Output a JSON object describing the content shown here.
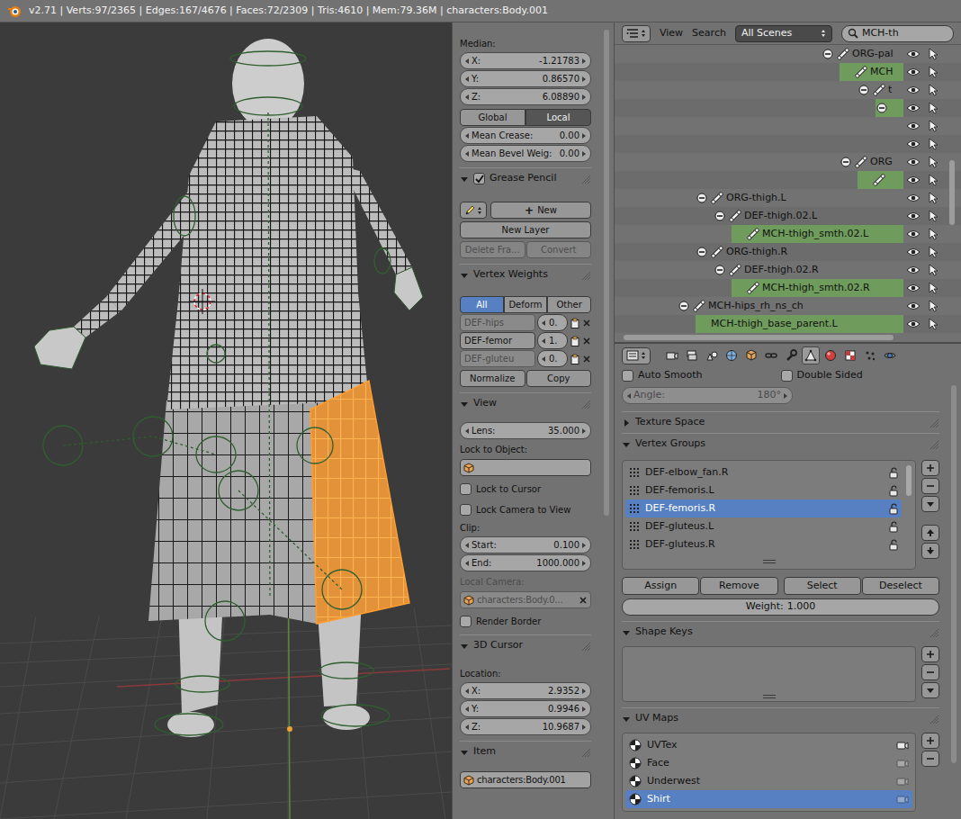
{
  "info_bar": {
    "text": "v2.71 | Verts:97/2365 | Edges:167/4676 | Faces:72/2309 | Tris:4610 | Mem:79.36M | characters:Body.001"
  },
  "n_panel": {
    "rows": [
      {
        "kind": "label",
        "text": "Median:",
        "disabled": false
      },
      {
        "kind": "number",
        "label": "X:",
        "value": "-1.21783"
      },
      {
        "kind": "number",
        "label": "Y:",
        "value": "0.86570"
      },
      {
        "kind": "number",
        "label": "Z:",
        "value": "6.08890"
      },
      {
        "kind": "radio",
        "items": [
          {
            "label": "Global",
            "selected": false
          },
          {
            "label": "Local",
            "selected": true
          }
        ]
      },
      {
        "kind": "number",
        "label": "Mean Crease:",
        "value": "0.00"
      },
      {
        "kind": "number",
        "label": "Mean Bevel Weig:",
        "value": "0.00"
      },
      {
        "kind": "header",
        "title": "Grease Pencil",
        "expanded": true,
        "checkbox": true,
        "checked": true
      },
      {
        "kind": "gp_new",
        "icon": "+",
        "label": "New"
      },
      {
        "kind": "buttons",
        "items": [
          {
            "label": "New Layer",
            "disabled": false
          }
        ]
      },
      {
        "kind": "buttons",
        "items": [
          {
            "label": "Delete Fra...",
            "disabled": true
          },
          {
            "label": "Convert",
            "disabled": true
          }
        ]
      },
      {
        "kind": "header",
        "title": "Vertex Weights",
        "expanded": true,
        "checkbox": false,
        "checked": false
      },
      {
        "kind": "toggles",
        "items": [
          {
            "label": "All",
            "selected": true
          },
          {
            "label": "Deform",
            "selected": false
          },
          {
            "label": "Other",
            "selected": false
          }
        ]
      },
      {
        "kind": "weight",
        "name": "DEF-hips",
        "value": "0.",
        "active": false
      },
      {
        "kind": "weight",
        "name": "DEF-femor",
        "value": "1.",
        "active": true
      },
      {
        "kind": "weight",
        "name": "DEF-gluteu",
        "value": "0.",
        "active": false
      },
      {
        "kind": "buttons",
        "items": [
          {
            "label": "Normalize",
            "disabled": false
          },
          {
            "label": "Copy",
            "disabled": false
          }
        ]
      },
      {
        "kind": "header",
        "title": "View",
        "expanded": true,
        "checkbox": false,
        "checked": false
      },
      {
        "kind": "number",
        "label": "Lens:",
        "value": "35.000"
      },
      {
        "kind": "label",
        "text": "Lock to Object:",
        "disabled": false
      },
      {
        "kind": "object_field",
        "value": "",
        "disabled": false,
        "clear": false
      },
      {
        "kind": "checkbox",
        "label": "Lock to Cursor",
        "checked": false
      },
      {
        "kind": "checkbox",
        "label": "Lock Camera to View",
        "checked": false
      },
      {
        "kind": "label",
        "text": "Clip:",
        "disabled": false
      },
      {
        "kind": "number",
        "label": "Start:",
        "value": "0.100"
      },
      {
        "kind": "number",
        "label": "End:",
        "value": "1000.000"
      },
      {
        "kind": "label",
        "text": "Local Camera:",
        "disabled": true
      },
      {
        "kind": "object_field",
        "value": "characters:Body.0...",
        "disabled": true,
        "clear": true
      },
      {
        "kind": "checkbox",
        "label": "Render Border",
        "checked": false
      },
      {
        "kind": "header",
        "title": "3D Cursor",
        "expanded": true,
        "checkbox": false,
        "checked": false
      },
      {
        "kind": "label",
        "text": "Location:",
        "disabled": false
      },
      {
        "kind": "number",
        "label": "X:",
        "value": "2.9352"
      },
      {
        "kind": "number",
        "label": "Y:",
        "value": "0.9946"
      },
      {
        "kind": "number",
        "label": "Z:",
        "value": "10.9687"
      },
      {
        "kind": "header",
        "title": "Item",
        "expanded": true,
        "checkbox": false,
        "checked": false
      },
      {
        "kind": "object_field",
        "value": "characters:Body.001",
        "disabled": false,
        "clear": false
      }
    ]
  },
  "outliner": {
    "header": {
      "view": "View",
      "search": "Search",
      "scene": "All Scenes",
      "filter": "MCH-th"
    },
    "rows": [
      {
        "label": "ORG-pal",
        "depth": 8,
        "has_children": true,
        "expanded": true,
        "bone": true,
        "selected": false
      },
      {
        "label": "MCH",
        "depth": 9,
        "has_children": false,
        "expanded": false,
        "bone": true,
        "selected": true
      },
      {
        "label": "t",
        "depth": 10,
        "has_children": true,
        "expanded": true,
        "bone": true,
        "selected": false
      },
      {
        "label": "",
        "depth": 11,
        "has_children": true,
        "expanded": true,
        "bone": false,
        "selected": true
      },
      {
        "label": "",
        "depth": 11,
        "has_children": false,
        "expanded": false,
        "bone": false,
        "selected": false
      },
      {
        "label": "",
        "depth": 11,
        "has_children": false,
        "expanded": false,
        "bone": false,
        "selected": false
      },
      {
        "label": "ORG",
        "depth": 9,
        "has_children": true,
        "expanded": true,
        "bone": true,
        "selected": false
      },
      {
        "label": "",
        "depth": 10,
        "has_children": false,
        "expanded": false,
        "bone": true,
        "selected": true
      },
      {
        "label": "ORG-thigh.L",
        "depth": 1,
        "has_children": true,
        "expanded": true,
        "bone": true,
        "selected": false
      },
      {
        "label": "DEF-thigh.02.L",
        "depth": 2,
        "has_children": true,
        "expanded": true,
        "bone": true,
        "selected": false
      },
      {
        "label": "MCH-thigh_smth.02.L",
        "depth": 3,
        "has_children": false,
        "expanded": false,
        "bone": true,
        "selected": true
      },
      {
        "label": "ORG-thigh.R",
        "depth": 1,
        "has_children": true,
        "expanded": true,
        "bone": true,
        "selected": false
      },
      {
        "label": "DEF-thigh.02.R",
        "depth": 2,
        "has_children": true,
        "expanded": true,
        "bone": true,
        "selected": false
      },
      {
        "label": "MCH-thigh_smth.02.R",
        "depth": 3,
        "has_children": false,
        "expanded": false,
        "bone": true,
        "selected": true
      },
      {
        "label": "MCH-hips_rh_ns_ch",
        "depth": 0,
        "has_children": true,
        "expanded": true,
        "bone": true,
        "selected": false
      },
      {
        "label": "MCH-thigh_base_parent.L",
        "depth": 1,
        "has_children": false,
        "expanded": false,
        "bone": false,
        "selected": true
      }
    ]
  },
  "properties": {
    "tabs": [
      {
        "selected": false
      },
      {
        "selected": false
      },
      {
        "selected": false
      },
      {
        "selected": false
      },
      {
        "selected": false
      },
      {
        "selected": false
      },
      {
        "selected": false
      },
      {
        "selected": true
      },
      {
        "selected": false
      },
      {
        "selected": false
      },
      {
        "selected": false
      },
      {
        "selected": false
      }
    ],
    "auto_smooth": {
      "label": "Auto Smooth",
      "checked": false
    },
    "double_sided": {
      "label": "Double Sided",
      "checked": false
    },
    "angle": {
      "label": "Angle:",
      "value": "180°",
      "disabled": true
    },
    "texture_space": {
      "title": "Texture Space",
      "expanded": false
    },
    "vertex_groups": {
      "title": "Vertex Groups",
      "expanded": true,
      "items": [
        {
          "name": "DEF-elbow_fan.R",
          "selected": false,
          "locked": false
        },
        {
          "name": "DEF-femoris.L",
          "selected": false,
          "locked": false
        },
        {
          "name": "DEF-femoris.R",
          "selected": true,
          "locked": false
        },
        {
          "name": "DEF-gluteus.L",
          "selected": false,
          "locked": false
        },
        {
          "name": "DEF-gluteus.R",
          "selected": false,
          "locked": false
        }
      ],
      "buttons": [
        "Assign",
        "Remove",
        "Select",
        "Deselect"
      ],
      "weight": {
        "label": "Weight:",
        "value": "1.000"
      }
    },
    "shape_keys": {
      "title": "Shape Keys",
      "expanded": true
    },
    "uv_maps": {
      "title": "UV Maps",
      "expanded": true,
      "items": [
        {
          "name": "UVTex",
          "selected": false,
          "active_render": true
        },
        {
          "name": "Face",
          "selected": false,
          "active_render": false
        },
        {
          "name": "Underwest",
          "selected": false,
          "active_render": false
        },
        {
          "name": "Shirt",
          "selected": true,
          "active_render": false
        }
      ]
    }
  }
}
